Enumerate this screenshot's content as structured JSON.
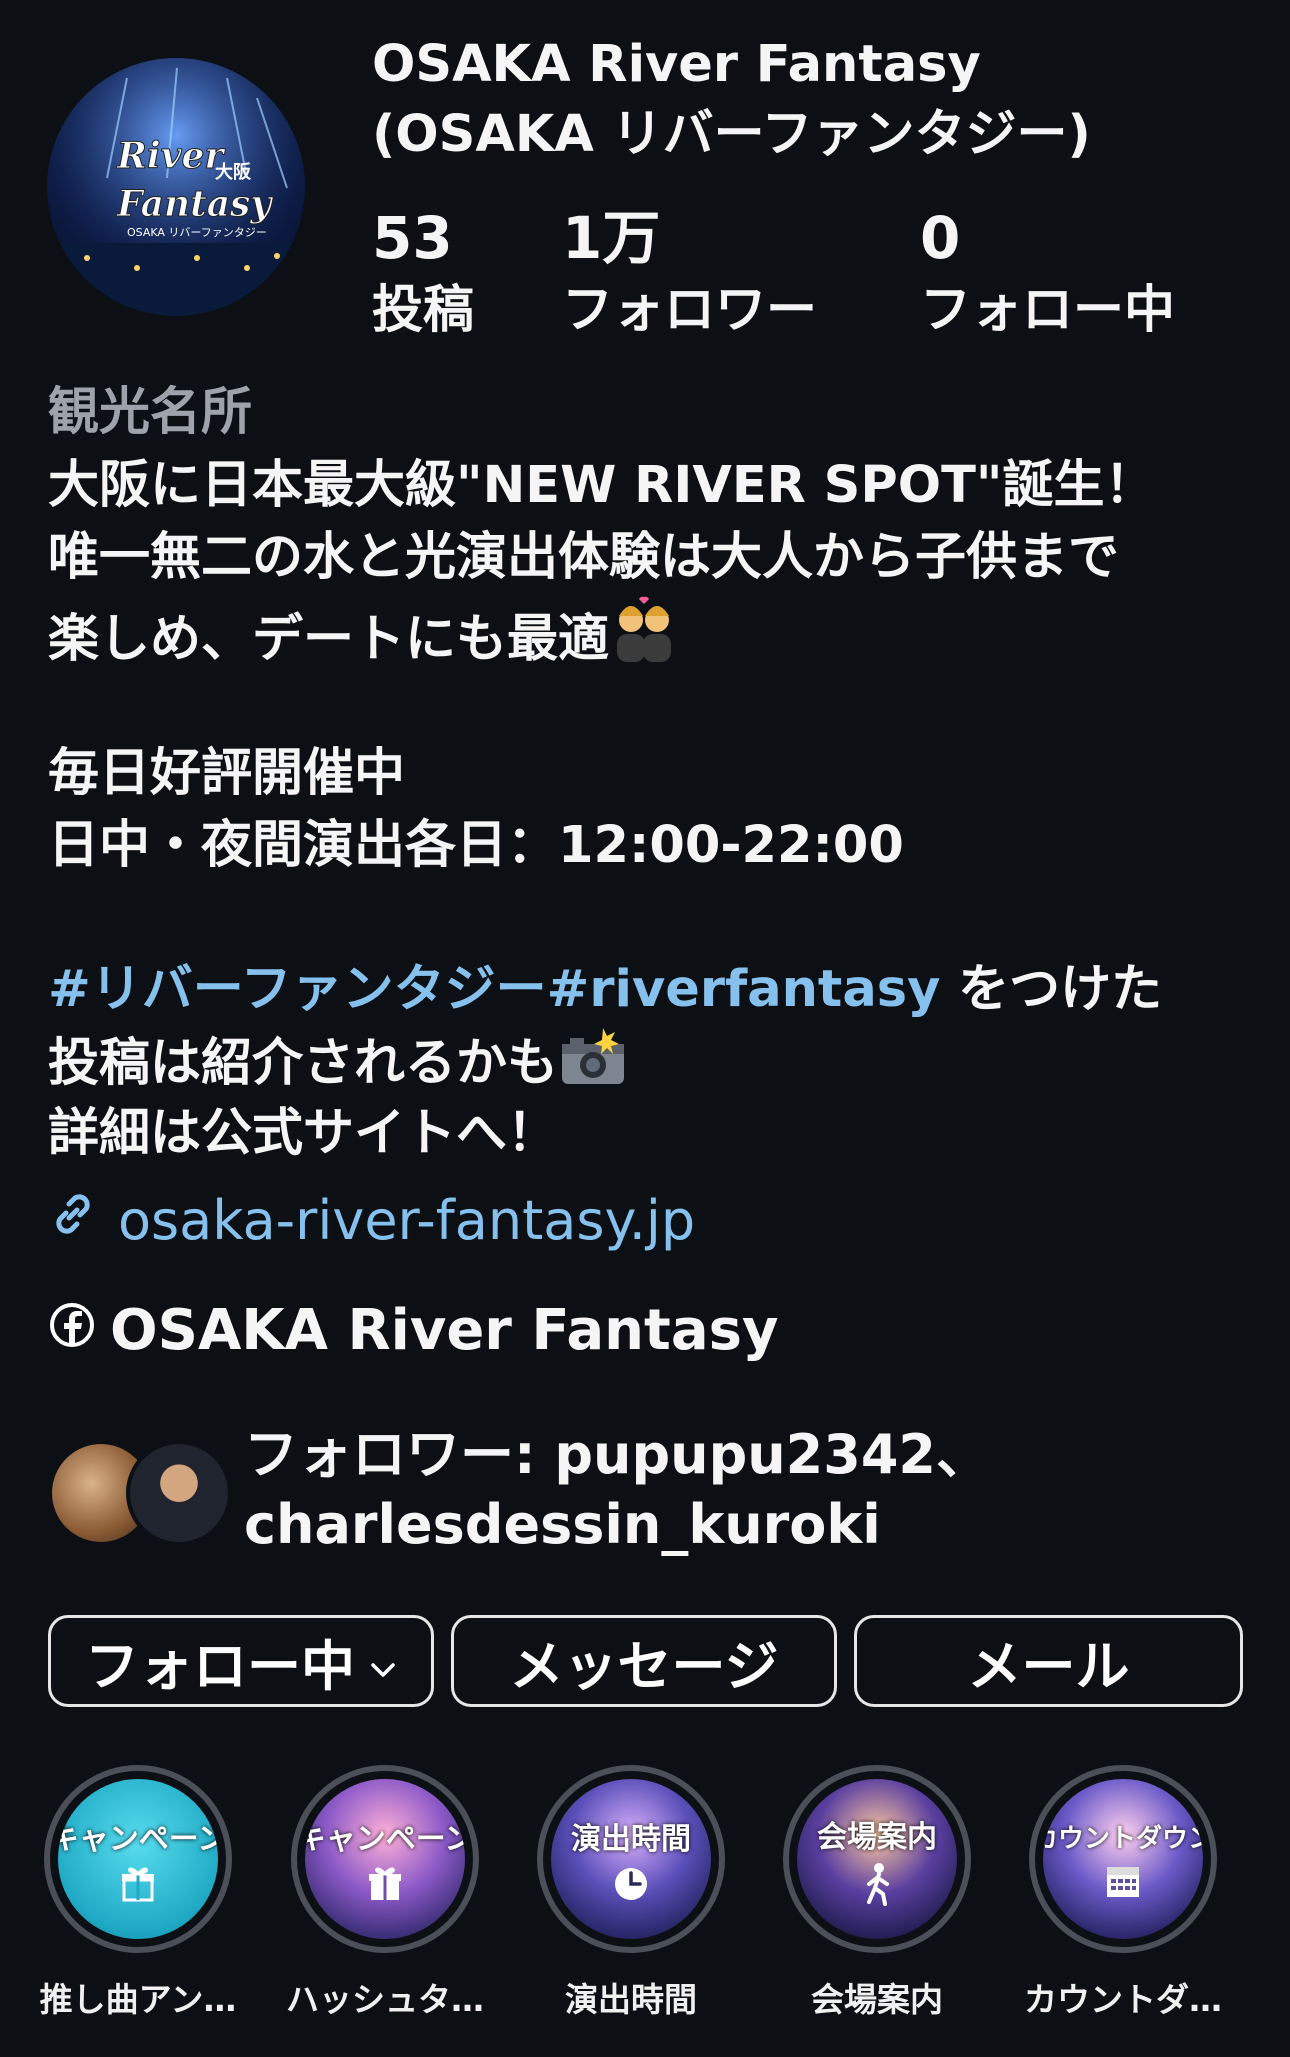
{
  "profile": {
    "name_line1": "OSAKA River Fantasy",
    "name_line2": "(OSAKA リバーファンタジー)",
    "avatar_logo_line1": "River",
    "avatar_logo_line2": "Fantasy",
    "avatar_logo_kanji": "大阪",
    "avatar_logo_sub": "OSAKA リバーファンタジー"
  },
  "stats": [
    {
      "value": "53",
      "label": "投稿"
    },
    {
      "value": "1万",
      "label": "フォロワー"
    },
    {
      "value": "0",
      "label": "フォロー中"
    }
  ],
  "category": "観光名所",
  "bio": {
    "line1": "大阪に日本最大級\"NEW RIVER SPOT\"誕生！",
    "line2": "唯一無二の水と光演出体験は大人から子供まで",
    "line3": "楽しめ、デートにも最適",
    "line3_emoji": "💑",
    "line4": "毎日好評開催中",
    "line5": "日中・夜間演出各日：12:00-22:00",
    "hashtags": " #リバーファンタジー#riverfantasy",
    "line6_tail": " をつけた",
    "line7": "投稿は紹介されるかも",
    "line7_emoji": "📸",
    "line8": "詳細は公式サイトへ！"
  },
  "link": {
    "text": "osaka-river-fantasy.jp",
    "icon": "link-icon"
  },
  "facebook": {
    "text": "OSAKA River Fantasy",
    "icon": "facebook-icon"
  },
  "followed_by": {
    "line1": "フォロワー: pupupu2342、",
    "line2": "charlesdessin_kuroki"
  },
  "buttons": {
    "following": "フォロー中",
    "message": "メッセージ",
    "email": "メール"
  },
  "highlights": [
    {
      "title": "キャンペーン",
      "icon": "gift-icon",
      "caption": "推し曲アン…",
      "color": "#2cc3d8"
    },
    {
      "title": "キャンペーン",
      "icon": "gift-icon",
      "caption": "ハッシュタ…",
      "color": "#6b4fa8"
    },
    {
      "title": "演出時間",
      "icon": "clock-icon",
      "caption": "演出時間",
      "color": "#3b3fa0"
    },
    {
      "title": "会場案内",
      "icon": "walking-person-icon",
      "caption": "会場案内",
      "color": "#2a3f8a"
    },
    {
      "title": "カウントダウン",
      "icon": "calendar-icon",
      "caption": "カウントダ…",
      "color": "#5a4fa0"
    }
  ]
}
